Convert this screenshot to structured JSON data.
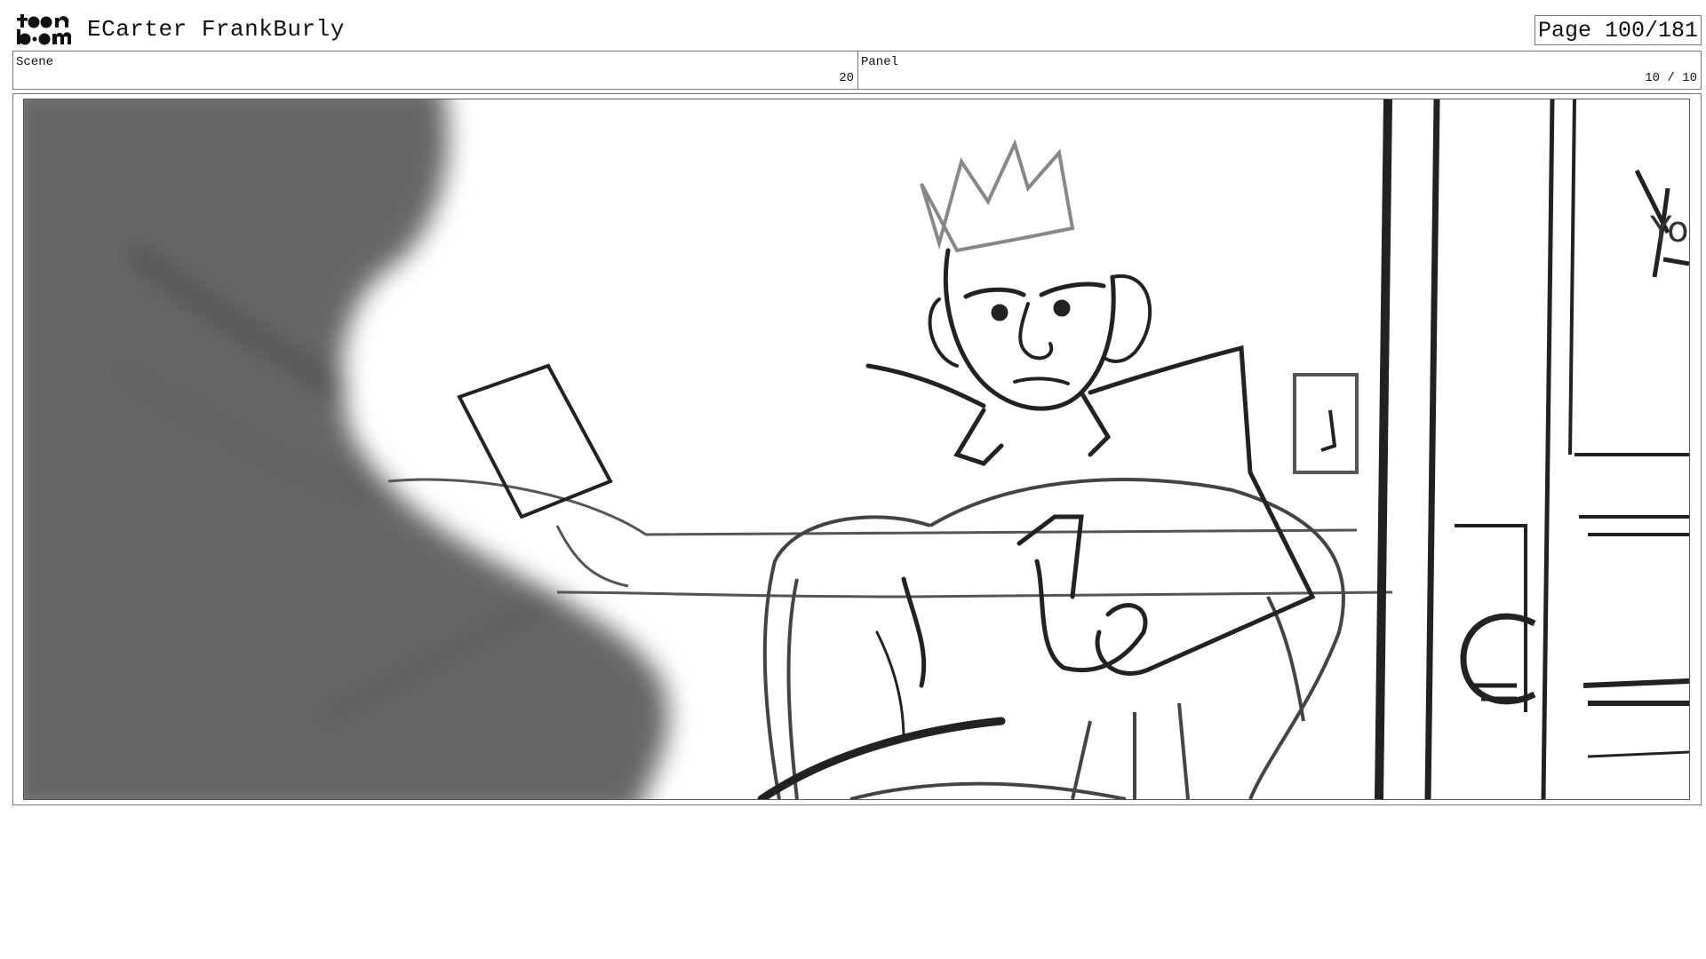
{
  "header": {
    "logo_text": "toon boom",
    "title": "ECarter FrankBurly",
    "page_indicator": "Page 100/181"
  },
  "scene": {
    "label": "Scene",
    "value": "20"
  },
  "panel": {
    "label": "Panel",
    "value": "10 / 10"
  },
  "drawing": {
    "sign_text": "Yo"
  }
}
